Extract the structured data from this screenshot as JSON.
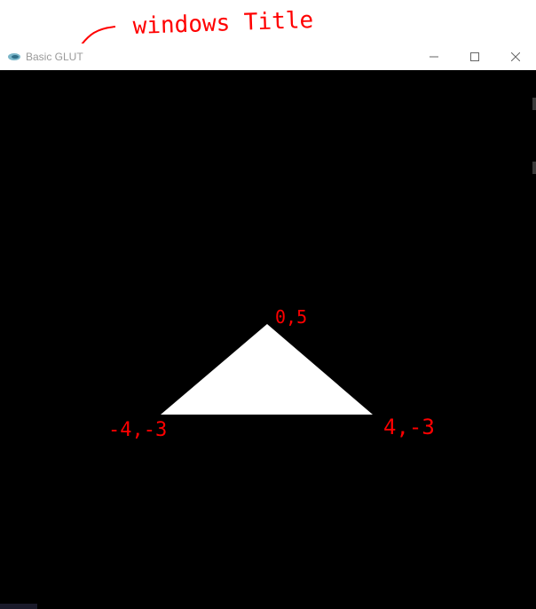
{
  "window": {
    "title": "Basic GLUT",
    "icon": "glut-app-icon",
    "controls": {
      "minimize_icon": "minimize-icon",
      "maximize_icon": "maximize-icon",
      "close_icon": "close-icon"
    }
  },
  "annotations": {
    "title_note": "windows Title",
    "top_vertex": "0,5",
    "left_vertex": "-4,-3",
    "right_vertex": "4,-3",
    "color": "#ff0000"
  },
  "scene": {
    "background": "#000000",
    "shape": "triangle",
    "fill": "#ffffff"
  }
}
